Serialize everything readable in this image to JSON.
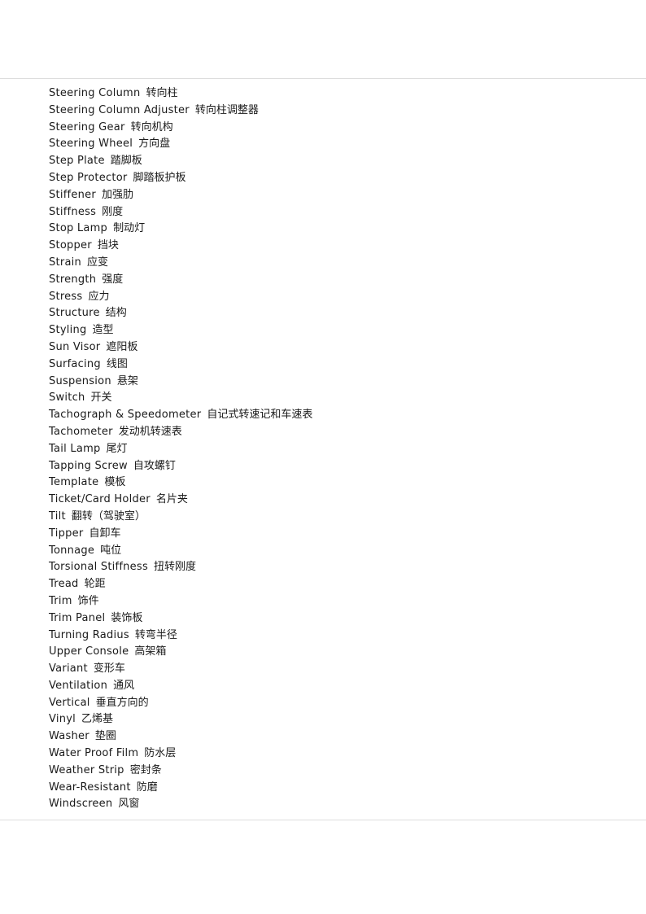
{
  "page": {
    "kind": "glossary-page",
    "rule_color": "#dddddd",
    "text_color": "#1a1a1a",
    "background": "#ffffff"
  },
  "glossary": {
    "entries": [
      {
        "term": "Steering Column",
        "definition": "转向柱"
      },
      {
        "term": "Steering Column Adjuster",
        "definition": "转向柱调整器"
      },
      {
        "term": "Steering Gear",
        "definition": "转向机构"
      },
      {
        "term": "Steering Wheel",
        "definition": "方向盘"
      },
      {
        "term": "Step Plate",
        "definition": "踏脚板"
      },
      {
        "term": "Step Protector",
        "definition": "脚踏板护板"
      },
      {
        "term": "Stiffener",
        "definition": "加强肋"
      },
      {
        "term": "Stiffness",
        "definition": "刚度"
      },
      {
        "term": "Stop Lamp",
        "definition": "制动灯"
      },
      {
        "term": "Stopper",
        "definition": "挡块"
      },
      {
        "term": "Strain",
        "definition": "应变"
      },
      {
        "term": "Strength",
        "definition": "强度"
      },
      {
        "term": "Stress",
        "definition": "应力"
      },
      {
        "term": "Structure",
        "definition": "结构"
      },
      {
        "term": "Styling",
        "definition": "造型"
      },
      {
        "term": "Sun Visor",
        "definition": "遮阳板"
      },
      {
        "term": "Surfacing",
        "definition": "线图"
      },
      {
        "term": "Suspension",
        "definition": "悬架"
      },
      {
        "term": "Switch",
        "definition": "开关"
      },
      {
        "term": "Tachograph & Speedometer",
        "definition": "自记式转速记和车速表"
      },
      {
        "term": "Tachometer",
        "definition": "发动机转速表"
      },
      {
        "term": "Tail Lamp",
        "definition": "尾灯"
      },
      {
        "term": "Tapping Screw",
        "definition": "自攻螺钉"
      },
      {
        "term": "Template",
        "definition": "模板"
      },
      {
        "term": "Ticket/Card Holder",
        "definition": "名片夹"
      },
      {
        "term": "Tilt",
        "definition": "翻转（驾驶室）"
      },
      {
        "term": "Tipper",
        "definition": "自卸车"
      },
      {
        "term": "Tonnage",
        "definition": "吨位"
      },
      {
        "term": "Torsional Stiffness",
        "definition": "扭转刚度"
      },
      {
        "term": "Tread",
        "definition": "轮距"
      },
      {
        "term": "Trim",
        "definition": "饰件"
      },
      {
        "term": "Trim Panel",
        "definition": "装饰板"
      },
      {
        "term": "Turning Radius",
        "definition": "转弯半径"
      },
      {
        "term": "Upper Console",
        "definition": "高架箱"
      },
      {
        "term": "Variant",
        "definition": "变形车"
      },
      {
        "term": "Ventilation",
        "definition": "通风"
      },
      {
        "term": "Vertical",
        "definition": "垂直方向的"
      },
      {
        "term": "Vinyl",
        "definition": "乙烯基"
      },
      {
        "term": "Washer",
        "definition": "垫圈"
      },
      {
        "term": "Water Proof Film",
        "definition": "防水层"
      },
      {
        "term": "Weather Strip",
        "definition": "密封条"
      },
      {
        "term": "Wear-Resistant",
        "definition": "防磨"
      },
      {
        "term": "Windscreen",
        "definition": "风窗"
      }
    ]
  }
}
